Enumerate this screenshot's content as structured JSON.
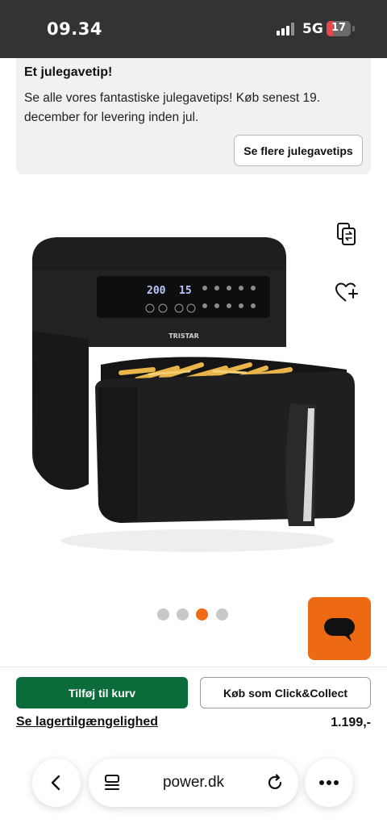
{
  "status_bar": {
    "time": "09.34",
    "network": "5G",
    "battery": "17"
  },
  "promo": {
    "title": "Et julegavetip!",
    "body": "Se alle vores fantastiske julegavetips! Køb senest 19. december for levering inden jul.",
    "button_label": "Se flere julegavetips"
  },
  "product": {
    "image_icon": "air-fryer-image",
    "brand_mark": "TRISTAR",
    "display_temp": "200",
    "display_time": "15",
    "carousel": {
      "count": 4,
      "active_index": 3
    }
  },
  "actions": {
    "add_to_cart": "Tilføj til kurv",
    "click_collect": "Køb som Click&Collect",
    "stock_link": "Se lagertilgængelighed",
    "price": "1.199,-"
  },
  "browser": {
    "url": "power.dk"
  },
  "colors": {
    "accent": "#ee6a12",
    "cart_green": "#0b6b3a",
    "status_bar": "#333333"
  }
}
